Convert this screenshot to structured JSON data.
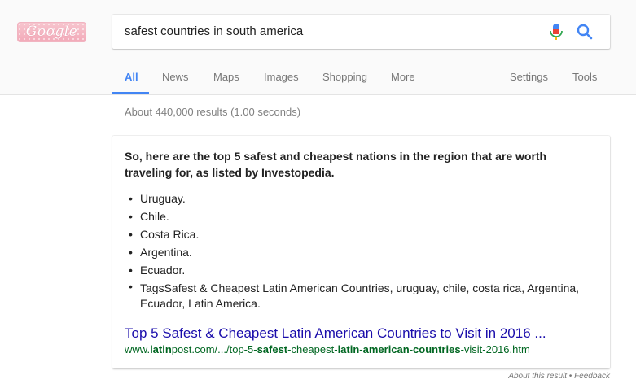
{
  "logo": {
    "text": "Google"
  },
  "search": {
    "query": "safest countries in south america"
  },
  "tabs": [
    {
      "label": "All"
    },
    {
      "label": "News"
    },
    {
      "label": "Maps"
    },
    {
      "label": "Images"
    },
    {
      "label": "Shopping"
    },
    {
      "label": "More"
    }
  ],
  "tools": {
    "settings": "Settings",
    "tools": "Tools"
  },
  "result_stats": "About 440,000 results (1.00 seconds)",
  "featured_snippet": {
    "heading": "So, here are the top 5 safest and cheapest nations in the region that are worth traveling for, as listed by Investopedia.",
    "items": [
      "Uruguay.",
      "Chile.",
      "Costa Rica.",
      "Argentina.",
      "Ecuador.",
      "TagsSafest & Cheapest Latin American Countries, uruguay, chile, costa rica, Argentina, Ecuador, Latin America."
    ],
    "link_title": "Top 5 Safest & Cheapest Latin American Countries to Visit in 2016 ...",
    "url_parts": [
      "www.",
      "latin",
      "post.com/.../top-5-",
      "safest",
      "-cheapest-",
      "latin-american-countries",
      "-visit-2016.htm"
    ]
  },
  "feedback": "About this result • Feedback",
  "colors": {
    "accent": "#4285f4",
    "link": "#1a0dab",
    "url": "#006621",
    "logo_bg": "#f2a9b8"
  }
}
